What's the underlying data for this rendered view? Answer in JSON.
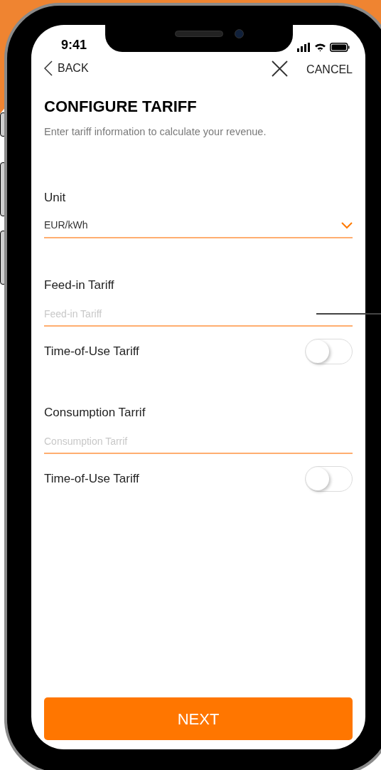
{
  "status_bar": {
    "time": "9:41"
  },
  "nav": {
    "back": "BACK",
    "cancel": "CANCEL"
  },
  "title": "CONFIGURE TARIFF",
  "subtitle": "Enter tariff information to calculate your revenue.",
  "unit": {
    "label": "Unit",
    "value": "EUR/kWh"
  },
  "tariffs": [
    {
      "label": "Feed-in Tariff",
      "placeholder": "Feed-in Tariff",
      "time_of_use": {
        "label": "Time-of-Use Tariff",
        "on": false
      }
    },
    {
      "label": "Consumption Tarrif",
      "placeholder": "Consumption Tarrif",
      "time_of_use": {
        "label": "Time-of-Use Tariff",
        "on": false
      }
    }
  ],
  "next_button": "NEXT"
}
